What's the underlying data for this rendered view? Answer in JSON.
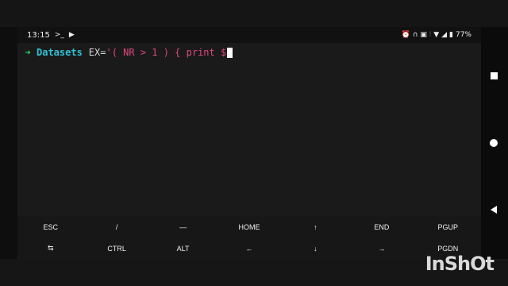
{
  "statusbar": {
    "time": "13:15",
    "left_icons": [
      "terminal-icon",
      "video-camera-icon"
    ],
    "right_icons": [
      "alarm-icon",
      "headphones-icon",
      "cast-icon",
      "vibrate-icon",
      "wifi-icon",
      "signal-icon",
      "battery-icon"
    ],
    "battery": "77%"
  },
  "terminal": {
    "arrow": "➜",
    "directory": "Datasets",
    "command_plain": "EX=",
    "command_string": "'( NR > 1 ) { print $"
  },
  "extra_keys": {
    "row1": [
      "ESC",
      "/",
      "—",
      "HOME",
      "↑",
      "END",
      "PGUP"
    ],
    "row2": [
      "⇆",
      "CTRL",
      "ALT",
      "←",
      "↓",
      "→",
      "PGDN"
    ]
  },
  "watermark": "InShOt",
  "colors": {
    "prompt_arrow": "#27d35a",
    "directory": "#2bc3d8",
    "string": "#e0467f",
    "background": "#1a1a1a"
  }
}
